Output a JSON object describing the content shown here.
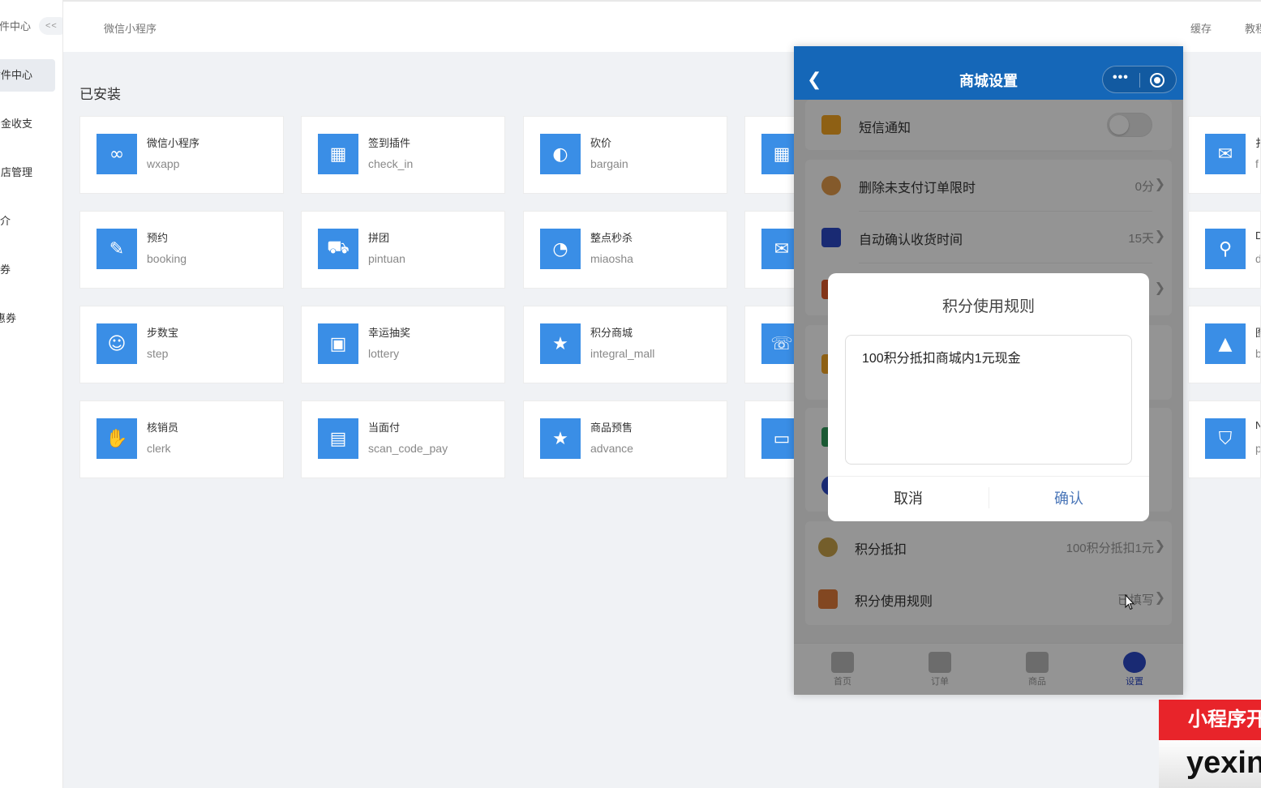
{
  "sidebar": {
    "top_label": "插件中心",
    "collapse_label": "<<",
    "items": [
      {
        "label": "插件中心",
        "active": true
      },
      {
        "label": "资金收支",
        "active": false
      },
      {
        "label": "门店管理",
        "active": false
      },
      {
        "label": "介",
        "active": false
      },
      {
        "label": "券",
        "active": false
      },
      {
        "label": "惠券",
        "active": false
      }
    ]
  },
  "topbar": {
    "breadcrumb": "微信小程序",
    "cache": "缓存",
    "tutorial": "教程"
  },
  "section_title": "已安装",
  "plugins": [
    {
      "name": "微信小程序",
      "code": "wxapp",
      "icon": "link-icon"
    },
    {
      "name": "签到插件",
      "code": "check_in",
      "icon": "calendar-icon"
    },
    {
      "name": "砍价",
      "code": "bargain",
      "icon": "knife-icon"
    },
    {
      "name": "",
      "code": "",
      "icon": "grid-icon"
    },
    {
      "name": "预约",
      "code": "booking",
      "icon": "memo-icon"
    },
    {
      "name": "拼团",
      "code": "pintuan",
      "icon": "cart-icon"
    },
    {
      "name": "整点秒杀",
      "code": "miaosha",
      "icon": "clock-icon"
    },
    {
      "name": "",
      "code": "",
      "icon": "ticket-icon"
    },
    {
      "name": "步数宝",
      "code": "step",
      "icon": "mascot-icon"
    },
    {
      "name": "幸运抽奖",
      "code": "lottery",
      "icon": "gift-box-icon"
    },
    {
      "name": "积分商城",
      "code": "integral_mall",
      "icon": "prize-icon"
    },
    {
      "name": "",
      "code": "",
      "icon": "phone-icon"
    },
    {
      "name": "核销员",
      "code": "clerk",
      "icon": "handshake-icon"
    },
    {
      "name": "当面付",
      "code": "scan_code_pay",
      "icon": "qr-pay-icon"
    },
    {
      "name": "商品预售",
      "code": "advance",
      "icon": "presale-icon"
    },
    {
      "name": "",
      "code": "",
      "icon": "card-icon"
    }
  ],
  "right_column": [
    {
      "name": "扌",
      "code": "f",
      "icon": "red-packet-icon"
    },
    {
      "name": "D",
      "code": "d",
      "icon": "search-map-icon"
    },
    {
      "name": "图",
      "code": "b",
      "icon": "cone-icon"
    },
    {
      "name": "N",
      "code": "p",
      "icon": "basket-icon"
    }
  ],
  "phone": {
    "title": "商城设置",
    "rows": {
      "sms": {
        "label": "短信通知"
      },
      "delete_unpaid": {
        "label": "删除未支付订单限时",
        "value": "0分"
      },
      "auto_confirm": {
        "label": "自动确认收货时间",
        "value": "15天"
      },
      "points_deduct": {
        "label": "积分抵扣",
        "value": "100积分抵扣1元"
      },
      "points_rule": {
        "label": "积分使用规则",
        "value": "已填写"
      }
    },
    "dialog": {
      "title": "积分使用规则",
      "text": "100积分抵扣商城内1元现金",
      "cancel": "取消",
      "confirm": "确认"
    },
    "tabs": [
      {
        "label": "首页",
        "icon": "home-icon"
      },
      {
        "label": "订单",
        "icon": "order-icon"
      },
      {
        "label": "商品",
        "icon": "goods-icon"
      },
      {
        "label": "设置",
        "icon": "settings-icon"
      }
    ]
  },
  "watermark": {
    "top": "小程序开",
    "bottom": "yexin"
  },
  "colors": {
    "accent": "#1567b8",
    "plugin_icon_bg": "#3a8ee6",
    "confirm": "#4a76b8"
  }
}
